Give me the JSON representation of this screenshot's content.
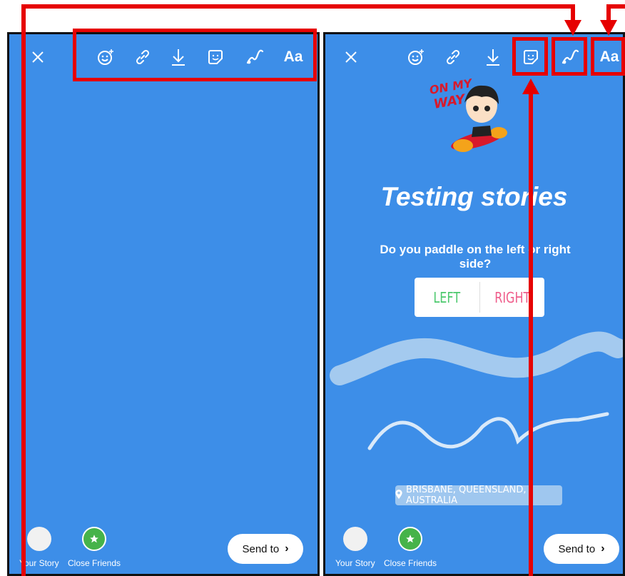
{
  "left_screen": {
    "toolbar": {
      "text_tool_label": "Aa"
    },
    "bottom": {
      "your_story_label": "Your Story",
      "close_friends_label": "Close Friends",
      "send_label": "Send to"
    }
  },
  "right_screen": {
    "toolbar": {
      "text_tool_label": "Aa"
    },
    "sticker_text": "ON MY WAY",
    "title": "Testing stories",
    "poll": {
      "question": "Do you paddle on the left or right side?",
      "option_left": "LEFT",
      "option_right": "RIGHT"
    },
    "location": "BRISBANE, QUEENSLAND, AUSTRALIA",
    "bottom": {
      "your_story_label": "Your Story",
      "close_friends_label": "Close Friends",
      "send_label": "Send to"
    }
  },
  "colors": {
    "background": "#3d8ee8",
    "highlight": "#e60000",
    "poll_left": "#4bc86c",
    "poll_right": "#ef5d8b",
    "close_friends": "#46b34a"
  },
  "icons": [
    "close-icon",
    "face-effects-icon",
    "link-icon",
    "download-icon",
    "sticker-icon",
    "draw-icon",
    "text-icon",
    "chevron-right-icon",
    "star-icon",
    "location-pin-icon"
  ]
}
